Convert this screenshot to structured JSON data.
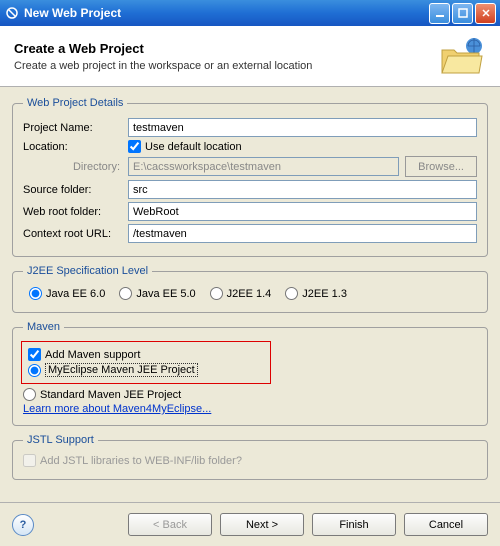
{
  "window": {
    "title": "New Web Project"
  },
  "header": {
    "title": "Create a Web Project",
    "subtitle": "Create a web project in the workspace or an external location"
  },
  "details": {
    "legend": "Web Project Details",
    "project_name_label": "Project Name:",
    "project_name": "testmaven",
    "location_label": "Location:",
    "use_default_label": "Use default location",
    "directory_label": "Directory:",
    "directory": "E:\\cacssworkspace\\testmaven",
    "browse_label": "Browse...",
    "source_folder_label": "Source folder:",
    "source_folder": "src",
    "web_root_label": "Web root folder:",
    "web_root": "WebRoot",
    "context_root_label": "Context root URL:",
    "context_root": "/testmaven"
  },
  "j2ee": {
    "legend": "J2EE Specification Level",
    "opt1": "Java EE 6.0",
    "opt2": "Java EE 5.0",
    "opt3": "J2EE 1.4",
    "opt4": "J2EE 1.3"
  },
  "maven": {
    "legend": "Maven",
    "add_support": "Add Maven support",
    "opt_myeclipse": "MyEclipse Maven JEE Project",
    "opt_standard": "Standard Maven JEE Project",
    "learn_more": "Learn more about Maven4MyEclipse..."
  },
  "jstl": {
    "legend": "JSTL Support",
    "add_label": "Add JSTL libraries to WEB-INF/lib folder?"
  },
  "footer": {
    "back": "< Back",
    "next": "Next >",
    "finish": "Finish",
    "cancel": "Cancel"
  }
}
